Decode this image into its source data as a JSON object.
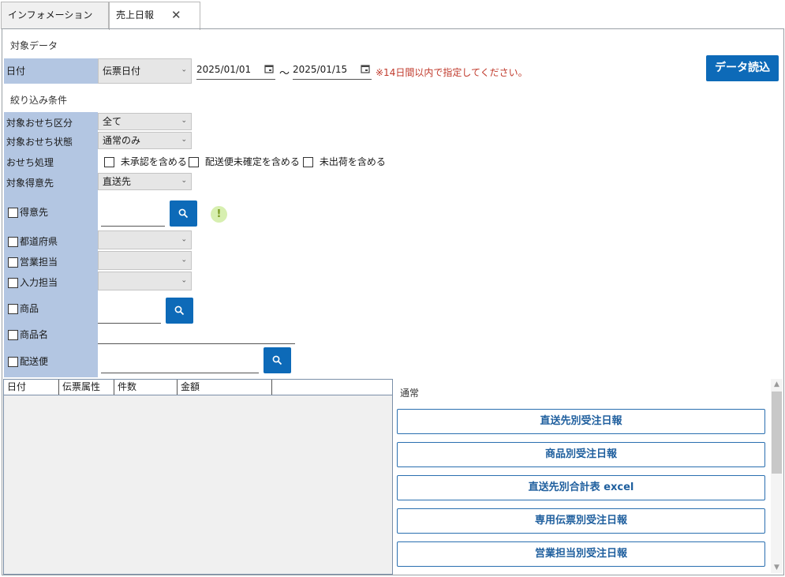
{
  "tabs": [
    {
      "label": "インフォメーション"
    },
    {
      "label": "売上日報"
    }
  ],
  "tab_close_glyph": "✕",
  "target_data_section": "対象データ",
  "date_row": {
    "label": "日付",
    "type_select": "伝票日付",
    "from": "2025/01/01",
    "tilde": "〜",
    "to": "2025/01/15",
    "notice": "※14日間以内で指定してください。"
  },
  "load_button": "データ読込",
  "filter_section": "絞り込み条件",
  "filters": {
    "osechi_category": {
      "label": "対象おせち区分",
      "value": "全て"
    },
    "osechi_status": {
      "label": "対象おせち状態",
      "value": "通常のみ"
    },
    "osechi_process": {
      "label": "おせち処理",
      "options": [
        "未承認を含める",
        "配送便未確定を含める",
        "未出荷を含める"
      ]
    },
    "customer_target": {
      "label": "対象得意先",
      "value": "直送先"
    },
    "customer": {
      "label": "得意先"
    },
    "prefecture": {
      "label": "都道府県"
    },
    "sales_rep": {
      "label": "営業担当"
    },
    "input_rep": {
      "label": "入力担当"
    },
    "product": {
      "label": "商品"
    },
    "product_name": {
      "label": "商品名"
    },
    "delivery": {
      "label": "配送便"
    }
  },
  "grid": {
    "columns": [
      "日付",
      "伝票属性",
      "件数",
      "金額",
      ""
    ]
  },
  "reports": {
    "label": "通常",
    "buttons": [
      "直送先別受注日報",
      "商品別受注日報",
      "直送先別合計表 excel",
      "専用伝票別受注日報",
      "営業担当別受注日報"
    ]
  },
  "colors": {
    "accent": "#0d6ab8",
    "label_bg": "#b3c6e2",
    "notice": "#c0392b"
  }
}
